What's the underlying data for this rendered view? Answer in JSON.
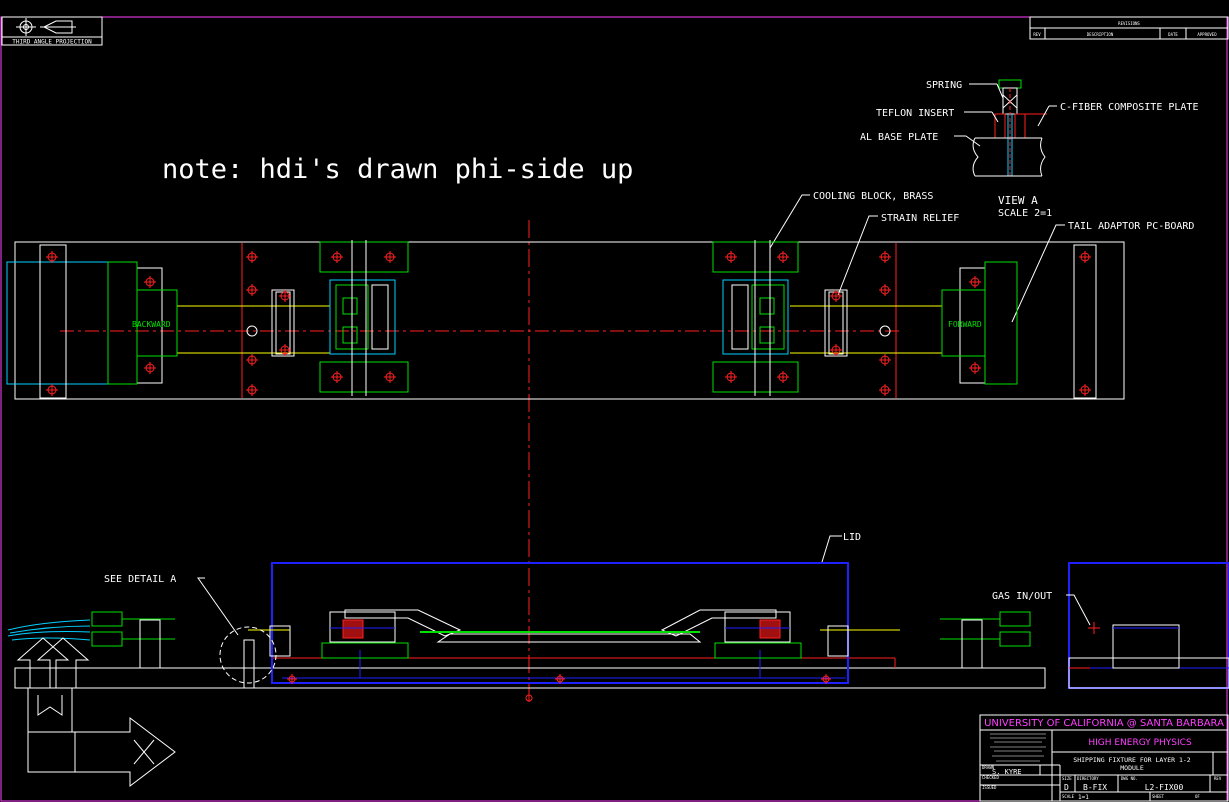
{
  "projection": {
    "label": "THIRD ANGLE PROJECTION"
  },
  "revisions": {
    "title": "REVISIONS",
    "cols": [
      "REV",
      "DESCRIPTION",
      "DATE",
      "APPROVED"
    ]
  },
  "note": "note: hdi's drawn phi-side up",
  "view_a": {
    "labels": {
      "spring": "SPRING",
      "teflon": "TEFLON INSERT",
      "al_base": "AL BASE PLATE",
      "c_fiber": "C-FIBER COMPOSITE PLATE"
    },
    "title": "VIEW A",
    "scale": "SCALE 2=1"
  },
  "callouts": {
    "cooling_block": "COOLING BLOCK, BRASS",
    "strain_relief": "STRAIN RELIEF",
    "tail_adaptor": "TAIL ADAPTOR PC-BOARD",
    "lid": "LID",
    "see_detail": "SEE DETAIL A",
    "gas": "GAS IN/OUT"
  },
  "plan_labels": {
    "backward": "BACKWARD",
    "forward": "FORWARD"
  },
  "title_block": {
    "university": "UNIVERSITY OF CALIFORNIA @ SANTA BARBARA",
    "dept": "HIGH ENERGY PHYSICS",
    "title_line1": "SHIPPING FIXTURE FOR LAYER 1-2",
    "title_line2": "MODULE",
    "drawn_label": "DRAWN",
    "drawn_by": "S. KYRE",
    "checked_label": "CHECKED",
    "issued_label": "ISSUED",
    "size_label": "SIZE",
    "size": "D",
    "directory_label": "DIRECTORY",
    "directory": "B-FIX",
    "dwg_label": "DWG NO.",
    "dwg_no": "L2-FIX00",
    "rev_label": "REV",
    "scale_label": "SCALE",
    "scale": "1=1",
    "sheet_label": "SHEET",
    "sheet_of": "OF"
  },
  "colors": {
    "background": "#000000",
    "outline": "#ffffff",
    "green": "#00e000",
    "red": "#ff2020",
    "blue": "#2020ff",
    "cyan": "#00d0ff",
    "magenta": "#ff40ff",
    "yellow": "#ffff00"
  }
}
